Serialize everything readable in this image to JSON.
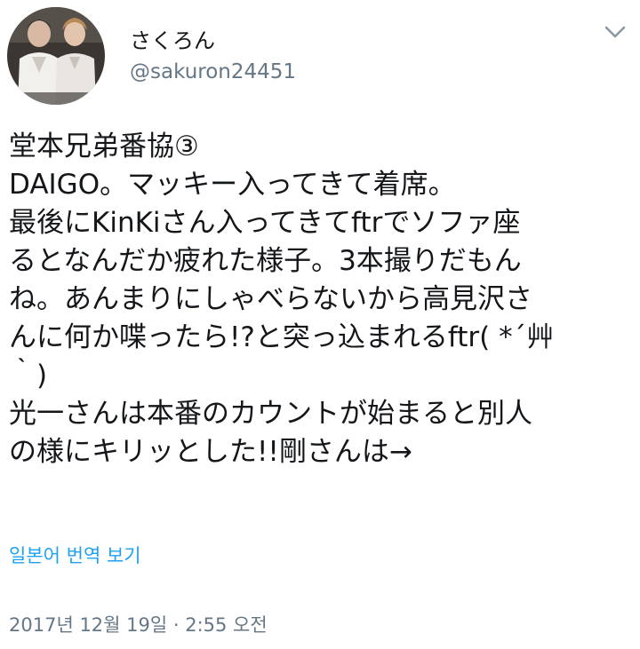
{
  "profile": {
    "display_name": "さくろん",
    "handle": "@sakuron24451"
  },
  "icons": {
    "avatar": "profile-photo",
    "caret": "chevron-down-icon"
  },
  "tweet": {
    "lines": [
      "堂本兄弟番協③",
      "DAIGO。マッキー入ってきて着席。",
      "最後にKinKiさん入ってきてftrでソファ座",
      "るとなんだか疲れた様子。3本撮りだもん",
      "ね。あんまりにしゃべらないから高見沢さ",
      "んに何か喋ったら!?と突っ込まれるftr( *´艸",
      "｀)",
      "光一さんは本番のカウントが始まると別人",
      "の様にキリッとした!!剛さんは→"
    ],
    "translate_label": "일본어 번역 보기",
    "timestamp": "2017년 12월 19일 · 2:55 오전"
  },
  "colors": {
    "text": "#14171a",
    "secondary": "#657786",
    "link": "#1da1f2"
  }
}
